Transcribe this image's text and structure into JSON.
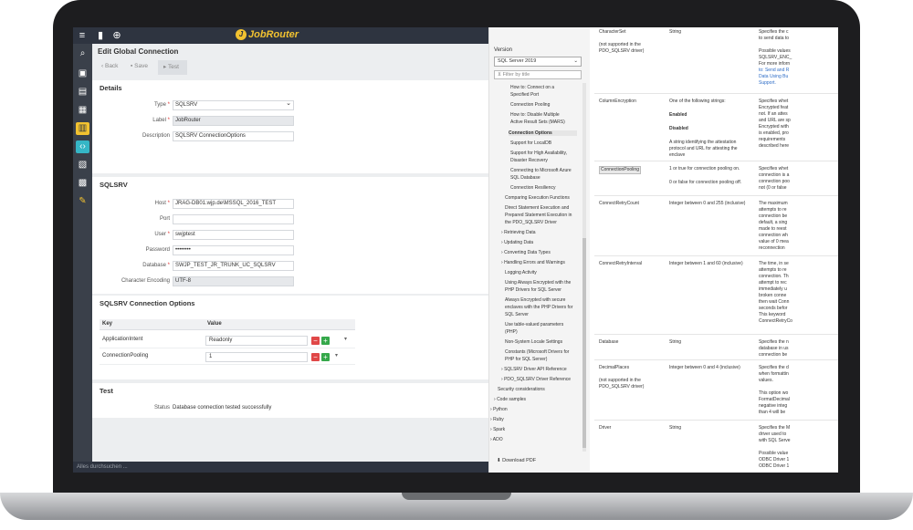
{
  "app": {
    "logo": "JobRouter",
    "page_title": "Edit Global Connection",
    "toolbar": {
      "back": "Back",
      "save": "Save",
      "test": "Test"
    },
    "details": {
      "heading": "Details",
      "type_label": "Type",
      "type_value": "SQLSRV",
      "label_label": "Label",
      "label_value": "JobRouter",
      "desc_label": "Description",
      "desc_value": "SQLSRV ConnectionOptions"
    },
    "sqlsrv": {
      "heading": "SQLSRV",
      "host_label": "Host",
      "host_value": "JRAG-DB01.wjp.de\\MSSQL_2016_TEST",
      "port_label": "Port",
      "port_value": "",
      "user_label": "User",
      "user_value": "swjptest",
      "password_label": "Password",
      "password_value": "••••••••",
      "database_label": "Database",
      "database_value": "SWJP_TEST_JR_TRUNK_UC_SQLSRV",
      "encoding_label": "Character Encoding",
      "encoding_value": "UTF-8"
    },
    "options": {
      "heading": "SQLSRV Connection Options",
      "key_header": "Key",
      "value_header": "Value",
      "rows": [
        {
          "key": "ApplicationIntent",
          "value": "Readonly"
        },
        {
          "key": "ConnectionPooling",
          "value": "1"
        }
      ]
    },
    "test": {
      "heading": "Test",
      "status_label": "Status",
      "status_value": "Database connection tested successfully"
    },
    "search_placeholder": "Alles durchsuchen ..."
  },
  "docs": {
    "version_label": "Version",
    "version_value": "SQL Server 2019",
    "filter_placeholder": "Filter by title",
    "tree": [
      "How to: Connect on a",
      "Specified Port",
      "Connection Pooling",
      "How to: Disable Multiple",
      "Active Result Sets (MARS)",
      "Connection Options",
      "Support for LocalDB",
      "Support for High Availability,",
      "Disaster Recovery",
      "Connecting to Microsoft Azure",
      "SQL Database",
      "Connection Resiliency",
      "Comparing Execution Functions",
      "Direct Statement Execution and",
      "Prepared Statement Execution in",
      "the PDO_SQLSRV Driver",
      "Retrieving Data",
      "Updating Data",
      "Converting Data Types",
      "Handling Errors and Warnings",
      "Logging Activity",
      "Using Always Encrypted with the",
      "PHP Drivers for SQL Server",
      "Always Encrypted with secure",
      "enclaves with the PHP Drivers for",
      "SQL Server",
      "Use table-valued parameters",
      "(PHP)",
      "Non-System Locale Settings",
      "Constants (Microsoft Drivers for",
      "PHP for SQL Server)",
      "SQLSRV Driver API Reference",
      "PDO_SQLSRV Driver Reference",
      "Security considerations",
      "Code samples",
      "Python",
      "Ruby",
      "Spark",
      "ADO"
    ],
    "download_pdf": "Download PDF",
    "table": {
      "characterset": {
        "name": "CharacterSet",
        "note": "(not supported in the",
        "note2": "PDO_SQLSRV driver)",
        "type": "String",
        "desc": [
          "Specifies the c",
          "to send data to",
          "",
          "Possible values",
          "SQLSRV_ENC_",
          "For more inforn",
          "to: Send and R",
          "Data Using Bu",
          "Support."
        ]
      },
      "columnencryption": {
        "name": "ColumnEncryption",
        "type": [
          "One of the following strings:",
          "",
          "Enabled",
          "",
          "Disabled",
          "",
          "A string identifying the attestation",
          "protocol and URL for attesting the",
          "enclave"
        ],
        "desc": [
          "Specifies whet",
          "Encrypted feat",
          "not. If an attes",
          "and URL are sp",
          "Encrypted with",
          "is enabled, pro",
          "requirements",
          "described here"
        ]
      },
      "connectionpooling": {
        "name": "ConnectionPooling",
        "type": [
          "1 or true for connection pooling on.",
          "",
          "0 or false for connection pooling off."
        ],
        "desc": [
          "Specifies whet",
          "connection is a",
          "connection poo",
          "not (0 or false"
        ]
      },
      "connectretrycount": {
        "name": "ConnectRetryCount",
        "type": "Integer between 0 and 255 (inclusive)",
        "desc": [
          "The maximum",
          "attempts to re",
          "connection be",
          "default, a sing",
          "made to reest",
          "connection wh",
          "value of 0 mea",
          "reconnection"
        ]
      },
      "connectretryinterval": {
        "name": "ConnectRetryInterval",
        "type": "Integer between 1 and 60 (inclusive)",
        "desc": [
          "The time, in se",
          "attempts to re",
          "connection. Th",
          "attempt to rec",
          "immediately u",
          "broken conne",
          "then wait Conn",
          "seconds befor",
          "This keyword",
          "ConnectRetryCo"
        ]
      },
      "database": {
        "name": "Database",
        "type": "String",
        "desc": [
          "Specifies the n",
          "database in us",
          "connection be"
        ]
      },
      "decimalplaces": {
        "name": "DecimalPlaces",
        "note": "(not supported in the",
        "note2": "PDO_SQLSRV driver)",
        "type": "Integer between 0 and 4 (inclusive)",
        "desc": [
          "Specifies the d",
          "when formattin",
          "values.",
          "",
          "This option wo",
          "FormatDecimal",
          "negative integ",
          "than 4 will be"
        ]
      },
      "driver": {
        "name": "Driver",
        "type": "String",
        "desc": [
          "Specifies the M",
          "driver used to",
          "with SQL Serve",
          "",
          "Possible value",
          "ODBC Driver 1",
          "ODBC Driver 1"
        ]
      }
    }
  }
}
